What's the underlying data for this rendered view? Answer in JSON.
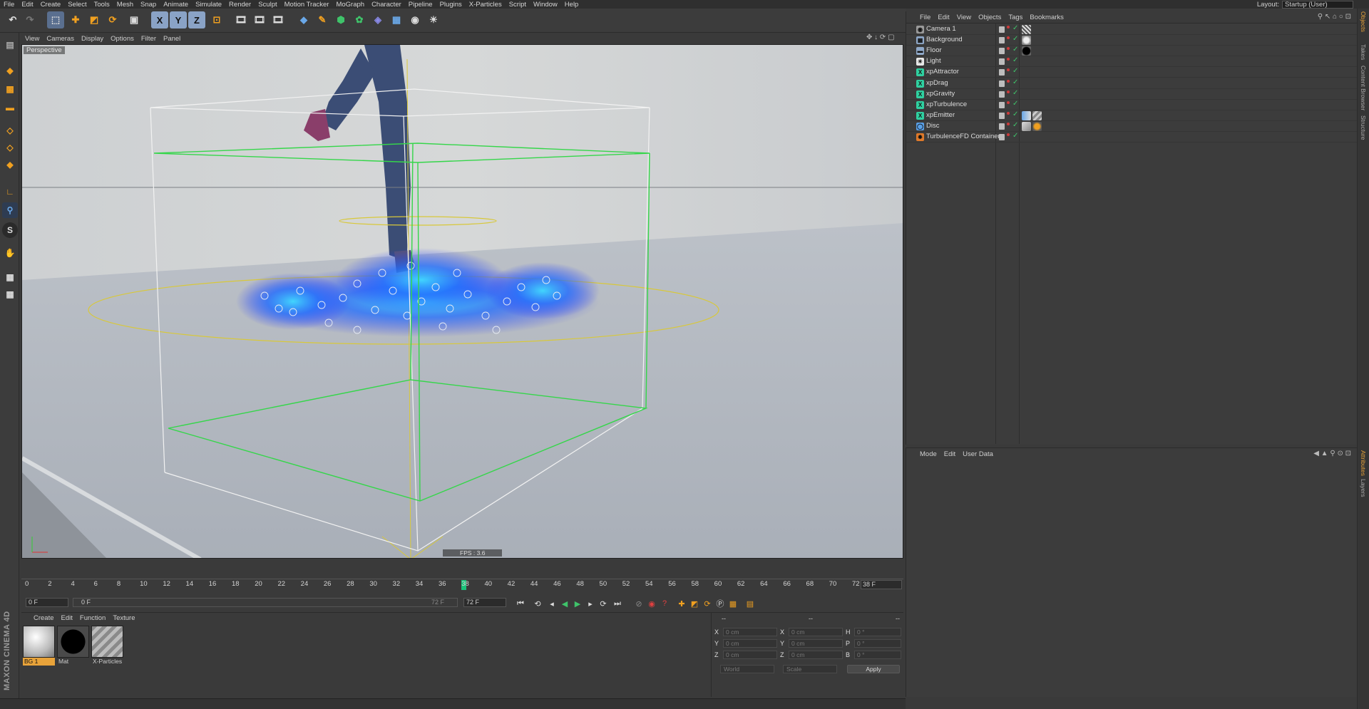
{
  "menubar": {
    "items": [
      "File",
      "Edit",
      "Create",
      "Select",
      "Tools",
      "Mesh",
      "Snap",
      "Animate",
      "Simulate",
      "Render",
      "Sculpt",
      "Motion Tracker",
      "MoGraph",
      "Character",
      "Pipeline",
      "Plugins",
      "X-Particles",
      "Script",
      "Window",
      "Help"
    ],
    "layout_label": "Layout:",
    "layout_value": "Startup (User)"
  },
  "toolbar": {
    "axis_x": "X",
    "axis_y": "Y",
    "axis_z": "Z"
  },
  "left_toolbar": {
    "snap_letter": "S"
  },
  "branding": {
    "logo_text": "MAXON CINEMA 4D"
  },
  "viewport": {
    "menu": [
      "View",
      "Cameras",
      "Display",
      "Options",
      "Filter",
      "Panel"
    ],
    "label": "Perspective",
    "fps": "FPS : 3.6"
  },
  "timeline": {
    "ticks": [
      "0",
      "2",
      "4",
      "6",
      "8",
      "10",
      "12",
      "14",
      "16",
      "18",
      "20",
      "22",
      "24",
      "26",
      "28",
      "30",
      "32",
      "34",
      "36",
      "38",
      "40",
      "42",
      "44",
      "46",
      "48",
      "50",
      "52",
      "54",
      "56",
      "58",
      "60",
      "62",
      "64",
      "66",
      "68",
      "70",
      "72"
    ],
    "current_frame": 38,
    "end_field": "38 F"
  },
  "transport": {
    "start_field": "0 F",
    "range_start": "0 F",
    "range_end": "72 F",
    "end_field": "72 F"
  },
  "material_manager": {
    "menu": [
      "Create",
      "Edit",
      "Function",
      "Texture"
    ],
    "materials": [
      {
        "name": "BG 1",
        "selected": true
      },
      {
        "name": "Mat",
        "selected": false
      },
      {
        "name": "X-Particles",
        "selected": false
      }
    ]
  },
  "coordinates": {
    "headers": [
      "--",
      "--",
      "--"
    ],
    "rows": [
      {
        "k1": "X",
        "v1": "0 cm",
        "k2": "X",
        "v2": "0 cm",
        "k3": "H",
        "v3": "0 °"
      },
      {
        "k1": "Y",
        "v1": "0 cm",
        "k2": "Y",
        "v2": "0 cm",
        "k3": "P",
        "v3": "0 °"
      },
      {
        "k1": "Z",
        "v1": "0 cm",
        "k2": "Z",
        "v2": "0 cm",
        "k3": "B",
        "v3": "0 °"
      }
    ],
    "mode_world": "World",
    "mode_scale": "Scale",
    "apply_label": "Apply"
  },
  "object_manager": {
    "menu": [
      "File",
      "Edit",
      "View",
      "Objects",
      "Tags",
      "Bookmarks"
    ],
    "objects": [
      {
        "name": "Camera 1",
        "icon": "camera-icon",
        "color": "#9a9a9a"
      },
      {
        "name": "Background",
        "icon": "background-icon",
        "color": "#8fa8c8"
      },
      {
        "name": "Floor",
        "icon": "floor-icon",
        "color": "#8fa8c8"
      },
      {
        "name": "Light",
        "icon": "light-icon",
        "color": "#e8e8e8"
      },
      {
        "name": "xpAttractor",
        "icon": "xp-attractor-icon",
        "color": "#2fd0a0"
      },
      {
        "name": "xpDrag",
        "icon": "xp-drag-icon",
        "color": "#2fd0a0"
      },
      {
        "name": "xpGravity",
        "icon": "xp-gravity-icon",
        "color": "#2fd0a0"
      },
      {
        "name": "xpTurbulence",
        "icon": "xp-turbulence-icon",
        "color": "#2fd0a0"
      },
      {
        "name": "xpEmitter",
        "icon": "xp-emitter-icon",
        "color": "#2fd0a0"
      },
      {
        "name": "Disc",
        "icon": "disc-icon",
        "color": "#5aa0e8"
      },
      {
        "name": "TurbulenceFD Container",
        "icon": "turbulencefd-icon",
        "color": "#e07a2a"
      }
    ]
  },
  "attributes": {
    "menu": [
      "Mode",
      "Edit",
      "User Data"
    ]
  },
  "right_tabs": [
    "Objects",
    "Takes",
    "Content Browser",
    "Structure",
    "Attributes",
    "Layers"
  ]
}
